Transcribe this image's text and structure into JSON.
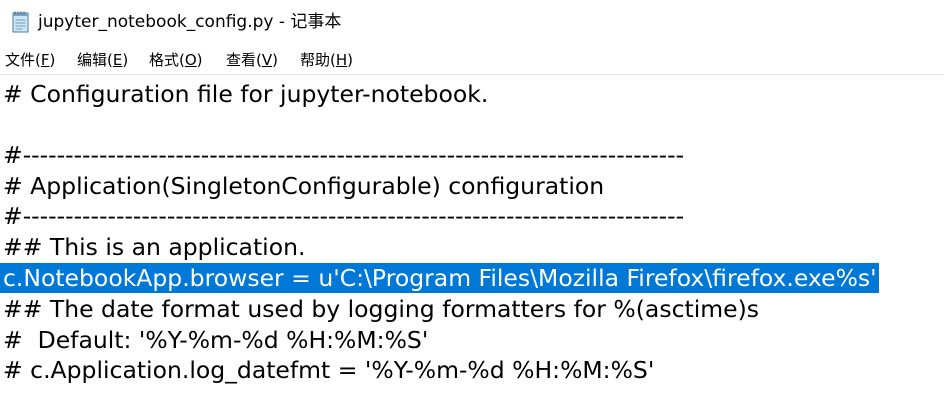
{
  "window": {
    "title": "jupyter_notebook_config.py - 记事本",
    "icon": "notepad-icon"
  },
  "menu": [
    {
      "label": "文件(",
      "accel": "F",
      "end": ")"
    },
    {
      "label": "编辑(",
      "accel": "E",
      "end": ")"
    },
    {
      "label": "格式(",
      "accel": "O",
      "end": ")"
    },
    {
      "label": "查看(",
      "accel": "V",
      "end": ")"
    },
    {
      "label": "帮助(",
      "accel": "H",
      "end": ")"
    }
  ],
  "editor": {
    "lines": [
      "# Configuration file for jupyter-notebook.",
      "",
      "#------------------------------------------------------------------------------",
      "# Application(SingletonConfigurable) configuration",
      "#------------------------------------------------------------------------------",
      "## This is an application.",
      "c.NotebookApp.browser = u'C:\\Program Files\\Mozilla Firefox\\firefox.exe%s'",
      "## The date format used by logging formatters for %(asctime)s",
      "#  Default: '%Y-%m-%d %H:%M:%S'",
      "# c.Application.log_datefmt = '%Y-%m-%d %H:%M:%S'"
    ],
    "selection_color": "#0078d7"
  }
}
